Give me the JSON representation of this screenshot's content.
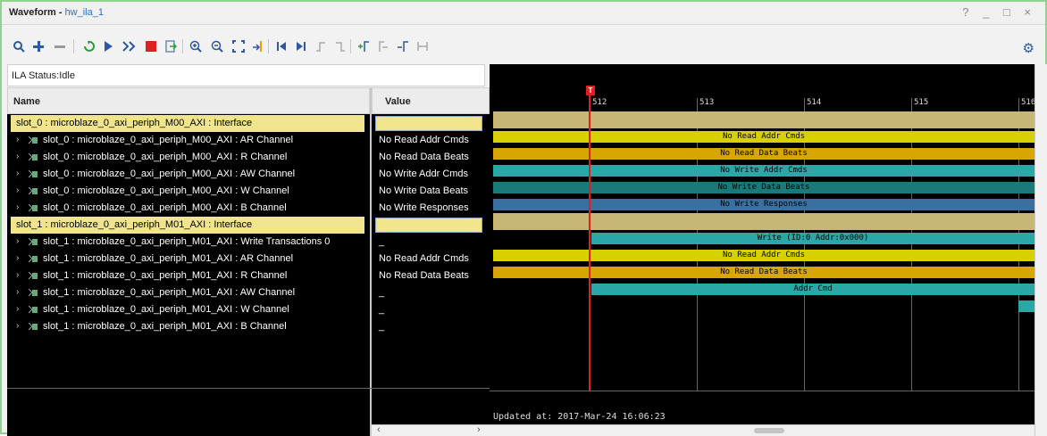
{
  "window": {
    "title": "Waveform -",
    "subtitle": "hw_ila_1",
    "controls": "? _ □ ×"
  },
  "ila_status": "ILA Status:Idle",
  "columns": {
    "name": "Name",
    "value": "Value"
  },
  "rows": [
    {
      "label": "slot_0 : microblaze_0_axi_periph_M00_AXI : Interface",
      "value": "",
      "interface": true
    },
    {
      "label": "slot_0 : microblaze_0_axi_periph_M00_AXI : AR Channel",
      "value": "No Read Addr Cmds"
    },
    {
      "label": "slot_0 : microblaze_0_axi_periph_M00_AXI : R Channel",
      "value": "No Read Data Beats"
    },
    {
      "label": "slot_0 : microblaze_0_axi_periph_M00_AXI : AW Channel",
      "value": "No Write Addr Cmds"
    },
    {
      "label": "slot_0 : microblaze_0_axi_periph_M00_AXI : W Channel",
      "value": "No Write Data Beats"
    },
    {
      "label": "slot_0 : microblaze_0_axi_periph_M00_AXI : B Channel",
      "value": "No Write Responses"
    },
    {
      "label": "slot_1 : microblaze_0_axi_periph_M01_AXI : Interface",
      "value": "",
      "interface": true
    },
    {
      "label": "slot_1 : microblaze_0_axi_periph_M01_AXI : Write Transactions 0",
      "value": "_"
    },
    {
      "label": "slot_1 : microblaze_0_axi_periph_M01_AXI : AR Channel",
      "value": "No Read Addr Cmds"
    },
    {
      "label": "slot_1 : microblaze_0_axi_periph_M01_AXI : R Channel",
      "value": "No Read Data Beats"
    },
    {
      "label": "slot_1 : microblaze_0_axi_periph_M01_AXI : AW Channel",
      "value": "_"
    },
    {
      "label": "slot_1 : microblaze_0_axi_periph_M01_AXI : W Channel",
      "value": "_"
    },
    {
      "label": "slot_1 : microblaze_0_axi_periph_M01_AXI : B Channel",
      "value": "_"
    }
  ],
  "timeline": {
    "ticks": [
      "512",
      "513",
      "514",
      "515",
      "516"
    ],
    "marker_label": "T",
    "updated": "Updated at: 2017-Mar-24 16:06:23"
  },
  "waves": [
    {
      "text": "",
      "color": "#c6b777"
    },
    {
      "text": "No Read Addr Cmds",
      "color": "#d8d000"
    },
    {
      "text": "No Read Data Beats",
      "color": "#d8a600"
    },
    {
      "text": "No Write Addr Cmds",
      "color": "#2aa8a8"
    },
    {
      "text": "No Write Data Beats",
      "color": "#1a7a7a"
    },
    {
      "text": "No Write Responses",
      "color": "#3a70a0"
    },
    {
      "text": "",
      "color": "#c6b777"
    },
    {
      "text": "Write (ID:0 Addr:0x000)",
      "color": "#2aa8a8"
    },
    {
      "text": "No Read Addr Cmds",
      "color": "#d8d000"
    },
    {
      "text": "No Read Data Beats",
      "color": "#d8a600"
    },
    {
      "text": "Addr Cmd",
      "color": "#2aa8a8"
    },
    {
      "text": "",
      "color": "#2aa8a8"
    },
    {
      "text": "",
      "color": ""
    }
  ],
  "colors": {
    "accent": "#2c58a4",
    "cursor": "#e02020",
    "interface_bg": "#f0e58c",
    "window_border": "#8fd38f"
  }
}
